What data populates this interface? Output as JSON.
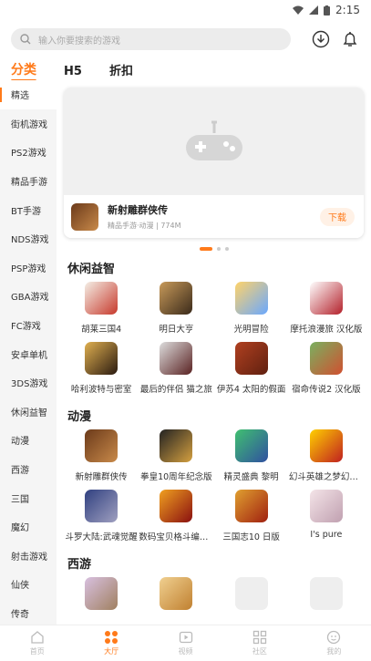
{
  "status": {
    "time": "2:15"
  },
  "search": {
    "placeholder": "输入你要搜索的游戏"
  },
  "tabs": [
    "分类",
    "H5",
    "折扣"
  ],
  "sidebar": [
    "精选",
    "街机游戏",
    "PS2游戏",
    "精品手游",
    "BT手游",
    "NDS游戏",
    "PSP游戏",
    "GBA游戏",
    "FC游戏",
    "安卓单机",
    "3DS游戏",
    "休闲益智",
    "动漫",
    "西游",
    "三国",
    "魔幻",
    "射击游戏",
    "仙侠",
    "传奇"
  ],
  "banner": {
    "title": "新射雕群侠传",
    "subtitle": "精品手游·动漫 | 774M",
    "button": "下载"
  },
  "sections": [
    {
      "title": "休闲益智",
      "games": [
        "胡莱三国4",
        "明日大亨",
        "光明冒险",
        "摩托浪漫旅 汉化版",
        "哈利波特与密室",
        "最后的伴侣 猫之旅",
        "伊苏4 太阳的假面",
        "宿命传说2 汉化版"
      ]
    },
    {
      "title": "动漫",
      "games": [
        "新射雕群侠传",
        "拳皇10周年纪念版",
        "精灵盛典 黎明",
        "幻斗英雄之梦幻西游",
        "斗罗大陆:武魂觉醒",
        "数码宝贝格斗编年史",
        "三国志10 日版",
        "I's pure"
      ]
    },
    {
      "title": "西游",
      "games": []
    }
  ],
  "bottom_nav": [
    "首页",
    "大厅",
    "视频",
    "社区",
    "我的"
  ],
  "colors": {
    "accent": "#ff7a1a"
  }
}
